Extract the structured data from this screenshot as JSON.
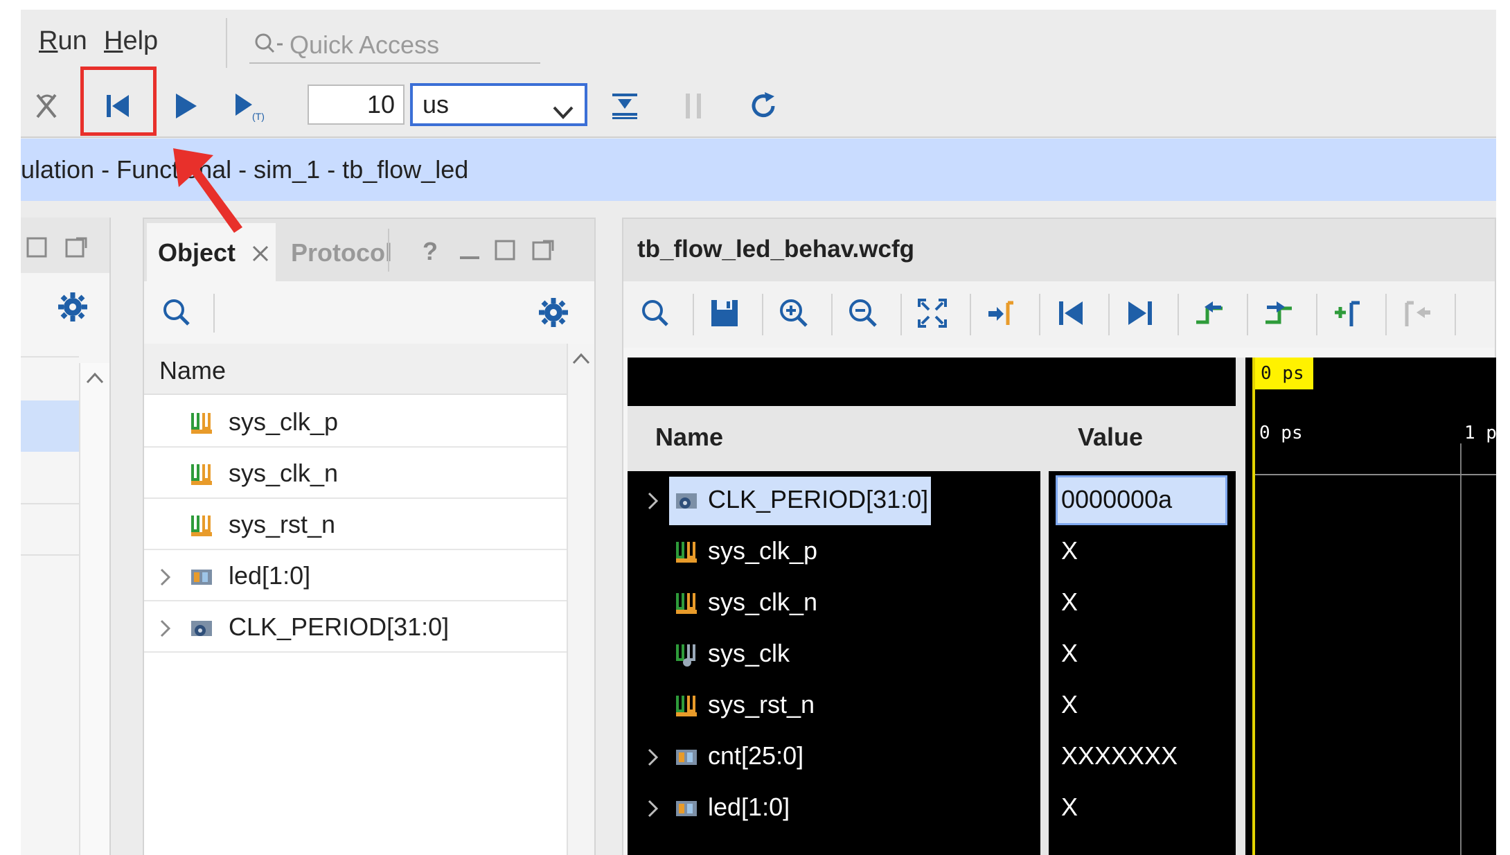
{
  "menu": {
    "run": {
      "underline": "R",
      "rest": "un"
    },
    "help": {
      "underline": "H",
      "rest": "elp"
    },
    "quick_access_placeholder": "Quick Access"
  },
  "toolbar": {
    "run_for_value": "10",
    "run_for_unit": "us",
    "highlighted_button": "restart-button"
  },
  "breadcrumb": "ulation - Functional - sim_1 - tb_flow_led",
  "object_panel": {
    "tabs": [
      "Object",
      "Protocol"
    ],
    "help_icon_text": "?",
    "column_header": "Name",
    "items": [
      {
        "name": "sys_clk_p",
        "icon": "signal-icon",
        "expandable": false
      },
      {
        "name": "sys_clk_n",
        "icon": "signal-icon",
        "expandable": false
      },
      {
        "name": "sys_rst_n",
        "icon": "signal-icon",
        "expandable": false
      },
      {
        "name": "led[1:0]",
        "icon": "bus-icon",
        "expandable": true
      },
      {
        "name": "CLK_PERIOD[31:0]",
        "icon": "parameter-icon",
        "expandable": true
      }
    ]
  },
  "waveform": {
    "title": "tb_flow_led_behav.wcfg",
    "name_header": "Name",
    "value_header": "Value",
    "cursor_label": "0 ps",
    "tick_labels": [
      "0 ps",
      "1 p"
    ],
    "signals": [
      {
        "name": "CLK_PERIOD[31:0]",
        "value": "0000000a",
        "expandable": true,
        "selected": true,
        "icon": "parameter-icon"
      },
      {
        "name": "sys_clk_p",
        "value": "X",
        "expandable": false,
        "selected": false,
        "icon": "signal-icon"
      },
      {
        "name": "sys_clk_n",
        "value": "X",
        "expandable": false,
        "selected": false,
        "icon": "signal-icon"
      },
      {
        "name": "sys_clk",
        "value": "X",
        "expandable": false,
        "selected": false,
        "icon": "internal-signal-icon"
      },
      {
        "name": "sys_rst_n",
        "value": "X",
        "expandable": false,
        "selected": false,
        "icon": "signal-icon"
      },
      {
        "name": "cnt[25:0]",
        "value": "XXXXXXX",
        "expandable": true,
        "selected": false,
        "icon": "bus-icon"
      },
      {
        "name": "led[1:0]",
        "value": "X",
        "expandable": true,
        "selected": false,
        "icon": "bus-icon"
      }
    ]
  },
  "colors": {
    "accent_blue": "#3b6fd6",
    "selection": "#cfe0fb",
    "highlight_red": "#e8302b",
    "cursor_yellow": "#fff200",
    "green_icon": "#2e9b3a",
    "orange_icon": "#e89b2a"
  }
}
